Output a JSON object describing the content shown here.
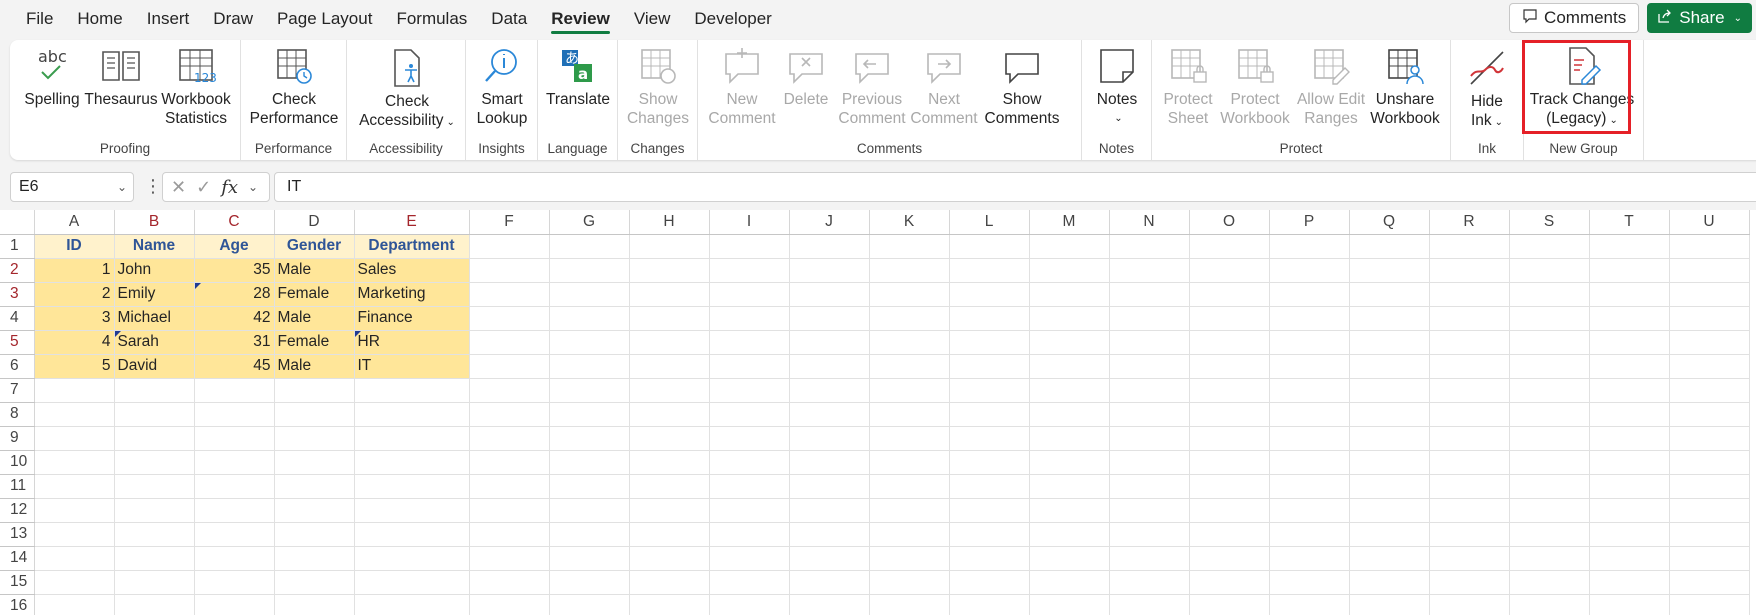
{
  "menu": {
    "tabs": [
      "File",
      "Home",
      "Insert",
      "Draw",
      "Page Layout",
      "Formulas",
      "Data",
      "Review",
      "View",
      "Developer"
    ],
    "active_tab": "Review",
    "comments_label": "Comments",
    "share_label": "Share"
  },
  "ribbon": {
    "groups": {
      "proofing": "Proofing",
      "performance": "Performance",
      "accessibility": "Accessibility",
      "insights": "Insights",
      "language": "Language",
      "changes": "Changes",
      "comments": "Comments",
      "notes": "Notes",
      "protect": "Protect",
      "ink": "Ink",
      "new_group": "New Group"
    },
    "buttons": {
      "spelling": "Spelling",
      "thesaurus": "Thesaurus",
      "workbook_statistics_1": "Workbook",
      "workbook_statistics_2": "Statistics",
      "check_performance_1": "Check",
      "check_performance_2": "Performance",
      "check_accessibility_1": "Check",
      "check_accessibility_2": "Accessibility",
      "smart_lookup_1": "Smart",
      "smart_lookup_2": "Lookup",
      "translate": "Translate",
      "show_changes_1": "Show",
      "show_changes_2": "Changes",
      "new_comment_1": "New",
      "new_comment_2": "Comment",
      "delete_comment": "Delete",
      "previous_comment_1": "Previous",
      "previous_comment_2": "Comment",
      "next_comment_1": "Next",
      "next_comment_2": "Comment",
      "show_comments_1": "Show",
      "show_comments_2": "Comments",
      "notes": "Notes",
      "protect_sheet_1": "Protect",
      "protect_sheet_2": "Sheet",
      "protect_workbook_1": "Protect",
      "protect_workbook_2": "Workbook",
      "allow_edit_ranges_1": "Allow Edit",
      "allow_edit_ranges_2": "Ranges",
      "unshare_workbook_1": "Unshare",
      "unshare_workbook_2": "Workbook",
      "hide_ink_1": "Hide",
      "hide_ink_2": "Ink",
      "track_changes_1": "Track Changes",
      "track_changes_2": "(Legacy)"
    },
    "highlighted": "Track Changes (Legacy)",
    "highlight_color": "#e52028"
  },
  "formula_bar": {
    "name_box": "E6",
    "fx": "fx",
    "content": "IT"
  },
  "sheet": {
    "columns": [
      "A",
      "B",
      "C",
      "D",
      "E",
      "F",
      "G",
      "H",
      "I",
      "J",
      "K",
      "L",
      "M",
      "N",
      "O",
      "P",
      "Q",
      "R",
      "S",
      "T",
      "U"
    ],
    "selected_columns": [
      "B",
      "C",
      "E"
    ],
    "rows": [
      "1",
      "2",
      "3",
      "4",
      "5",
      "6",
      "7",
      "8",
      "9",
      "10",
      "11",
      "12",
      "13",
      "14",
      "15",
      "16"
    ],
    "selected_rows": [
      "2",
      "3",
      "5"
    ],
    "header": [
      "ID",
      "Name",
      "Age",
      "Gender",
      "Department"
    ],
    "data": [
      [
        "1",
        "John",
        "35",
        "Male",
        "Sales"
      ],
      [
        "2",
        "Emily",
        "28",
        "Female",
        "Marketing"
      ],
      [
        "3",
        "Michael",
        "42",
        "Male",
        "Finance"
      ],
      [
        "4",
        "Sarah",
        "31",
        "Female",
        "HR"
      ],
      [
        "5",
        "David",
        "45",
        "Male",
        "IT"
      ]
    ],
    "header_fill": "#fff2cc",
    "data_fill": "#ffe699",
    "header_text_color": "#2f5597"
  }
}
